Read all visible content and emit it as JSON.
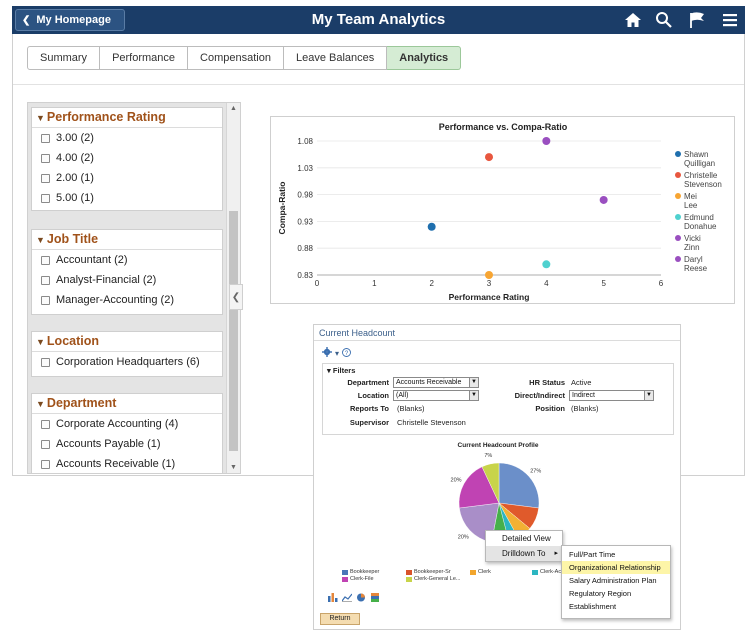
{
  "header": {
    "home_label": "My Homepage",
    "title": "My Team Analytics",
    "icons": [
      "home-icon",
      "search-icon",
      "flag-icon",
      "menu-icon"
    ]
  },
  "tabs": [
    {
      "label": "Summary",
      "active": false
    },
    {
      "label": "Performance",
      "active": false
    },
    {
      "label": "Compensation",
      "active": false
    },
    {
      "label": "Leave Balances",
      "active": false
    },
    {
      "label": "Analytics",
      "active": true
    }
  ],
  "facets": {
    "performance_rating": {
      "title": "Performance Rating",
      "items": [
        "3.00 (2)",
        "4.00 (2)",
        "2.00 (1)",
        "5.00 (1)"
      ]
    },
    "job_title": {
      "title": "Job Title",
      "items": [
        "Accountant (2)",
        "Analyst-Financial (2)",
        "Manager-Accounting (2)"
      ]
    },
    "location": {
      "title": "Location",
      "items": [
        "Corporation Headquarters (6)"
      ]
    },
    "department": {
      "title": "Department",
      "items": [
        "Corporate Accounting (4)",
        "Accounts Payable (1)",
        "Accounts Receivable (1)"
      ]
    }
  },
  "chart_data": [
    {
      "type": "scatter",
      "title": "Performance vs. Compa-Ratio",
      "xlabel": "Performance Rating",
      "ylabel": "Compa-Ratio",
      "xlim": [
        0,
        6
      ],
      "ylim": [
        0.83,
        1.08
      ],
      "xticks": [
        "0",
        "1",
        "2",
        "3",
        "4",
        "5",
        "6"
      ],
      "yticks": [
        "1.08",
        "1.03",
        "0.98",
        "0.93",
        "0.88",
        "0.83"
      ],
      "legend_position": "right",
      "series": [
        {
          "name": "Shawn Quilligan",
          "color": "#1f6fae",
          "x": 2,
          "y": 0.92
        },
        {
          "name": "Christelle Stevenson",
          "color": "#e8573f",
          "x": 3,
          "y": 1.05
        },
        {
          "name": "Mei Lee",
          "color": "#f7a533",
          "x": 3,
          "y": 0.83
        },
        {
          "name": "Edmund Donahue",
          "color": "#4fd1cf",
          "x": 4,
          "y": 0.85
        },
        {
          "name": "Vicki Zinn",
          "color": "#9a4fc0",
          "x": 5,
          "y": 0.97
        },
        {
          "name": "Daryl Reese",
          "color": "#9a4fc0",
          "x": 4,
          "y": 1.08
        }
      ]
    },
    {
      "type": "pie",
      "title": "Current Headcount Profile",
      "slices": [
        {
          "label": "27%",
          "value": 27,
          "color": "#6b8fc9"
        },
        {
          "label": "",
          "value": 9,
          "color": "#e05a2b"
        },
        {
          "label": "",
          "value": 6,
          "color": "#f2b134"
        },
        {
          "label": "",
          "value": 4,
          "color": "#2cb6c1"
        },
        {
          "label": "",
          "value": 7,
          "color": "#46b04a"
        },
        {
          "label": "20%",
          "value": 20,
          "color": "#a98ec8"
        },
        {
          "label": "20%",
          "value": 20,
          "color": "#c043b3"
        },
        {
          "label": "7%",
          "value": 7,
          "color": "#c8d44a"
        }
      ],
      "legend": [
        {
          "label": "Bookkeeper",
          "color": "#4a76b8"
        },
        {
          "label": "Bookkeeper-Sr",
          "color": "#d9532b"
        },
        {
          "label": "Clerk",
          "color": "#f2a52d"
        },
        {
          "label": "Clerk-Acc",
          "color": "#2cb6c1"
        },
        {
          "label": "Clerk-File",
          "color": "#c043b3"
        },
        {
          "label": "Clerk-General Le...",
          "color": "#c8d44a"
        }
      ]
    }
  ],
  "headcount": {
    "panel_title": "Current Headcount",
    "filters_label": "Filters",
    "department_label": "Department",
    "department_value": "Accounts Receivable",
    "location_label": "Location",
    "location_value": "(All)",
    "reports_to_label": "Reports To",
    "reports_to_value": "(Blanks)",
    "supervisor_label": "Supervisor",
    "supervisor_value": "Christelle Stevenson",
    "hr_status_label": "HR Status",
    "hr_status_value": "Active",
    "direct_label": "Direct/Indirect",
    "direct_value": "Indirect",
    "position_label": "Position",
    "position_value": "(Blanks)",
    "return_label": "Return"
  },
  "context_menu": {
    "items": [
      "Detailed View",
      "Drilldown To"
    ],
    "submenu": [
      "Full/Part Time",
      "Organizational Relationship",
      "Salary Administration Plan",
      "Regulatory Region",
      "Establishment"
    ],
    "highlighted_submenu": "Organizational Relationship"
  }
}
